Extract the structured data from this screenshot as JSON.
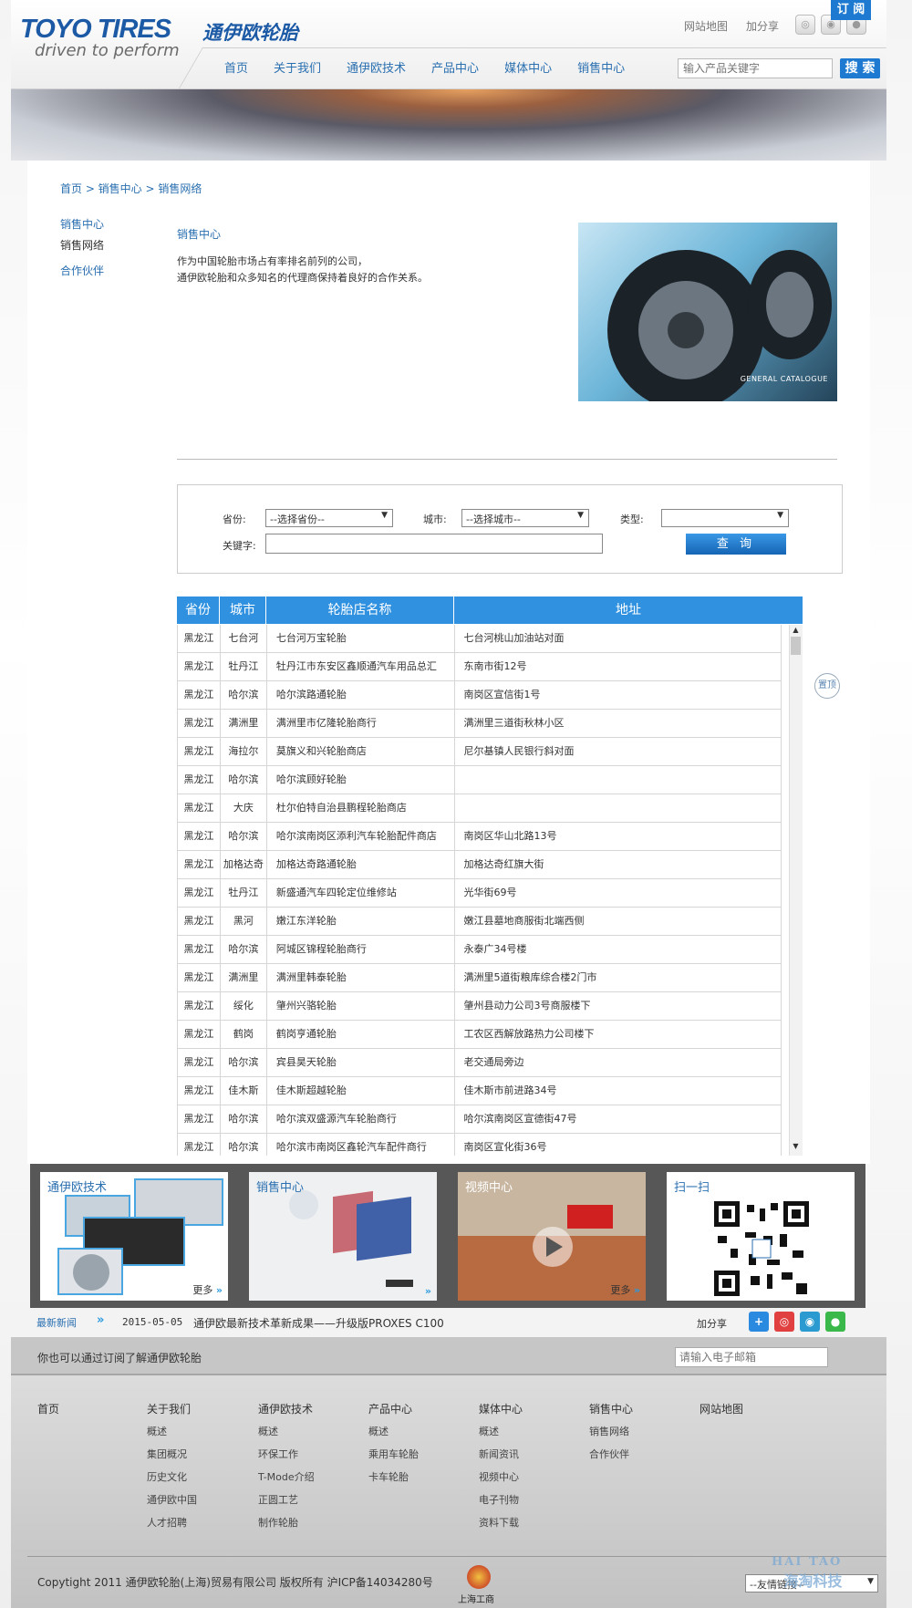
{
  "header": {
    "brand": "TOYO TIRES",
    "brand_cn": "通伊欧轮胎",
    "slogan": "driven to perform",
    "top_links": [
      "网站地图",
      "加分享"
    ],
    "nav": [
      "首页",
      "关于我们",
      "通伊欧技术",
      "产品中心",
      "媒体中心",
      "销售中心"
    ],
    "search_placeholder": "输入产品关键字",
    "search_button": "搜 索"
  },
  "breadcrumb": "首页 > 销售中心 > 销售网络",
  "sidebar": {
    "items": [
      {
        "label": "销售中心",
        "active": true
      },
      {
        "label": "销售网络",
        "active": false
      },
      {
        "label": "合作伙伴",
        "active": true
      }
    ]
  },
  "main": {
    "section_title": "销售中心",
    "intro_line1": "作为中国轮胎市场占有率排名前列的公司，",
    "intro_line2": "通伊欧轮胎和众多知名的代理商保持着良好的合作关系。",
    "catalog_label": "GENERAL CATALOGUE"
  },
  "filter": {
    "province_label": "省份:",
    "province_value": "--选择省份--",
    "city_label": "城市:",
    "city_value": "--选择城市--",
    "type_label": "类型:",
    "type_value": "",
    "keyword_label": "关键字:",
    "keyword_value": "",
    "query_button": "查 询"
  },
  "table": {
    "headers": [
      "省份",
      "城市",
      "轮胎店名称",
      "地址"
    ],
    "rows": [
      [
        "黑龙江",
        "七台河",
        "七台河万宝轮胎",
        "七台河桃山加油站对面"
      ],
      [
        "黑龙江",
        "牡丹江",
        "牡丹江市东安区鑫顺通汽车用品总汇",
        "东南市街12号"
      ],
      [
        "黑龙江",
        "哈尔滨",
        "哈尔滨路通轮胎",
        "南岗区宣信街1号"
      ],
      [
        "黑龙江",
        "满洲里",
        "满洲里市亿隆轮胎商行",
        "满洲里三道街秋林小区"
      ],
      [
        "黑龙江",
        "海拉尔",
        "莫旗义和兴轮胎商店",
        "尼尔基镇人民银行斜对面"
      ],
      [
        "黑龙江",
        "哈尔滨",
        "哈尔滨顾好轮胎",
        ""
      ],
      [
        "黑龙江",
        "大庆",
        "杜尔伯特自治县鹏程轮胎商店",
        ""
      ],
      [
        "黑龙江",
        "哈尔滨",
        "哈尔滨南岗区添利汽车轮胎配件商店",
        "南岗区华山北路13号"
      ],
      [
        "黑龙江",
        "加格达奇",
        "加格达奇路通轮胎",
        "加格达奇红旗大街"
      ],
      [
        "黑龙江",
        "牡丹江",
        "新盛通汽车四轮定位维修站",
        "光华街69号"
      ],
      [
        "黑龙江",
        "黑河",
        "嫩江东洋轮胎",
        "嫩江县墓地商服街北端西侧"
      ],
      [
        "黑龙江",
        "哈尔滨",
        "阿城区锦程轮胎商行",
        "永泰广34号楼"
      ],
      [
        "黑龙江",
        "满洲里",
        "满洲里韩泰轮胎",
        "满洲里5道街粮库综合楼2门市"
      ],
      [
        "黑龙江",
        "绥化",
        "肇州兴骆轮胎",
        "肇州县动力公司3号商服楼下"
      ],
      [
        "黑龙江",
        "鹤岗",
        "鹤岗亨通轮胎",
        "工农区西解放路热力公司楼下"
      ],
      [
        "黑龙江",
        "哈尔滨",
        "宾县昊天轮胎",
        "老交通局旁边"
      ],
      [
        "黑龙江",
        "佳木斯",
        "佳木斯超越轮胎",
        "佳木斯市前进路34号"
      ],
      [
        "黑龙江",
        "哈尔滨",
        "哈尔滨双盛源汽车轮胎商行",
        "哈尔滨南岗区宣德街47号"
      ],
      [
        "黑龙江",
        "哈尔滨",
        "哈尔滨市南岗区鑫轮汽车配件商行",
        "南岗区宣化街36号"
      ]
    ]
  },
  "back_to_top": "置顶",
  "tiles": [
    {
      "title": "通伊欧技术",
      "more": "更多"
    },
    {
      "title": "销售中心",
      "more": ""
    },
    {
      "title": "视频中心",
      "more": "更多"
    },
    {
      "title": "扫一扫",
      "more": ""
    }
  ],
  "news": {
    "label": "最新新闻",
    "date": "2015-05-05",
    "title": "通伊欧最新技术革新成果——升级版PROXES C100",
    "share_label": "加分享"
  },
  "subscribe": {
    "text": "你也可以通过订阅了解通伊欧轮胎",
    "placeholder": "请输入电子邮箱",
    "button": "订 阅"
  },
  "footer": {
    "columns": [
      {
        "heading": "首页",
        "items": []
      },
      {
        "heading": "关于我们",
        "items": [
          "概述",
          "集团概况",
          "历史文化",
          "通伊欧中国",
          "人才招聘"
        ]
      },
      {
        "heading": "通伊欧技术",
        "items": [
          "概述",
          "环保工作",
          "T-Mode介绍",
          "正圆工艺",
          "制作轮胎"
        ]
      },
      {
        "heading": "产品中心",
        "items": [
          "概述",
          "乘用车轮胎",
          "卡车轮胎"
        ]
      },
      {
        "heading": "媒体中心",
        "items": [
          "概述",
          "新闻资讯",
          "视频中心",
          "电子刊物",
          "资料下载"
        ]
      },
      {
        "heading": "销售中心",
        "items": [
          "销售网络",
          "合作伙伴"
        ]
      },
      {
        "heading": "网站地图",
        "items": []
      }
    ],
    "copyright": "Copytight 2011 通伊欧轮胎(上海)贸易有限公司 版权所有  沪ICP备14034280号",
    "emblem_label": "上海工商",
    "friend_links": "--友情链接--"
  },
  "watermark": {
    "line1": "HAI TAO",
    "line2": "海淘科技"
  },
  "colors": {
    "brand_blue": "#1c5aa6",
    "link_blue": "#2a6fb0",
    "table_header": "#2f91e0",
    "button_blue": "#1d7ad0"
  }
}
